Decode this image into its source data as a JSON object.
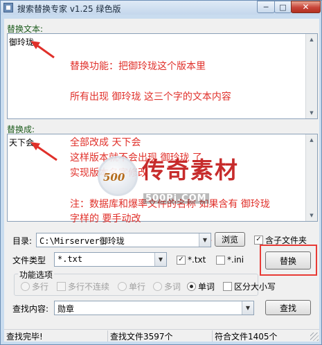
{
  "window": {
    "title": "搜索替换专家 v1.25   绿色版",
    "min_glyph": "─",
    "max_glyph": "□",
    "close_glyph": "✕"
  },
  "replace_text": {
    "label": "替换文本:",
    "value": "御玲珑"
  },
  "replace_with": {
    "label": "替换成:",
    "value": "天下会"
  },
  "annotations": {
    "line1": "替换功能：把御玲珑这个版本里",
    "line2": "所有出现 御玲珑 这三个字的文本内容",
    "line3": "全部改成 天下会",
    "line4": "这样版本就不会出现 御玲珑 了",
    "line5": "实现版本名字修改",
    "line6": "注：数据库和爆率文件的名称 如果含有 御玲珑",
    "line7": "字样的 要手动改"
  },
  "watermark": {
    "circle_text": "500",
    "chars": "传奇素材",
    "url": "500Pi.COM"
  },
  "directory": {
    "label": "目录:",
    "value": "C:\\Mirserver御玲珑",
    "browse_label": "浏览",
    "include_subfolders_label": "含子文件夹"
  },
  "file_type": {
    "label": "文件类型",
    "value": "*.txt",
    "txt_label": "*.txt",
    "ini_label": "*.ini",
    "replace_button": "替换"
  },
  "options": {
    "title": "功能选项",
    "multiline": "多行",
    "multiline_noncont": "多行不连续",
    "single_line": "单行",
    "multi_word": "多词",
    "single_word": "单词",
    "case_sensitive": "区分大小写"
  },
  "search": {
    "label": "查找内容:",
    "value": "勋章",
    "button": "查找"
  },
  "status": {
    "state": "查找完毕!",
    "files_found": "查找文件3597个",
    "files_matched": "符合文件1405个"
  },
  "colors": {
    "annotation": "#e0302a",
    "highlight_box": "#e83a35",
    "label_green": "#1a5a1a"
  }
}
